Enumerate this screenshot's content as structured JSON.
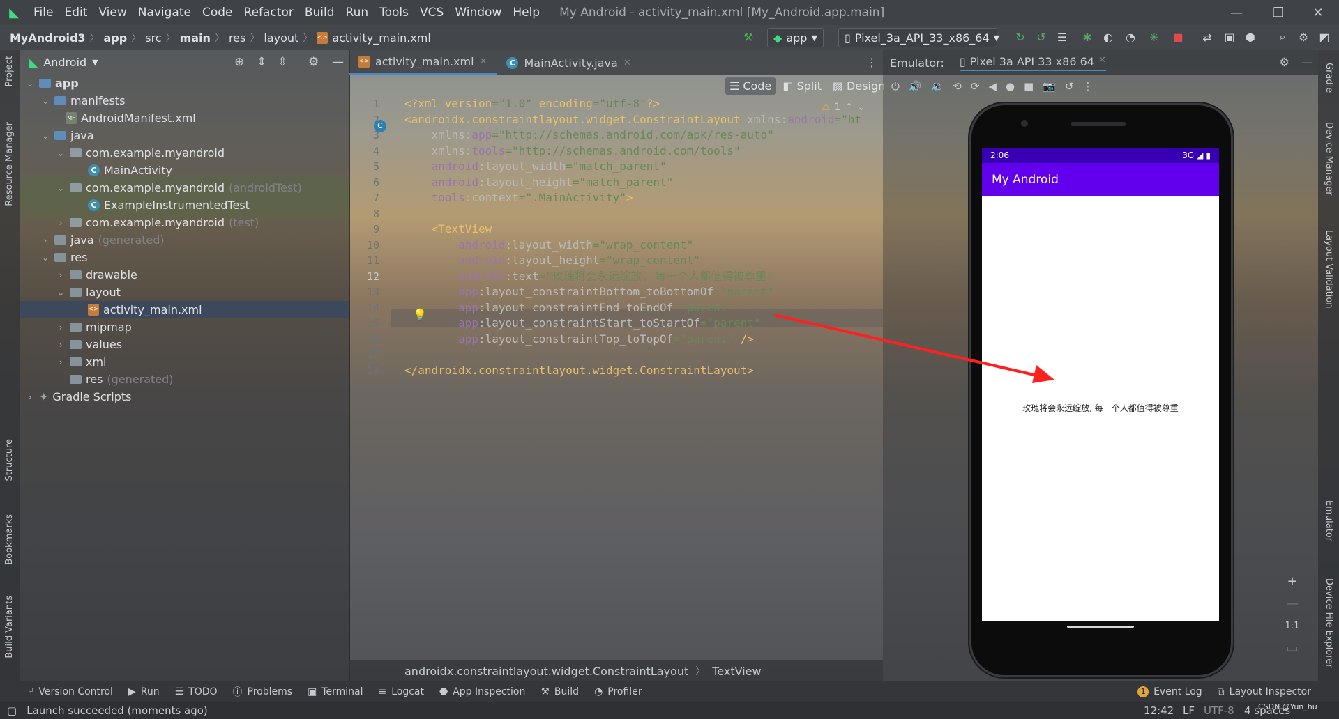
{
  "menubar": {
    "items": [
      "File",
      "Edit",
      "View",
      "Navigate",
      "Code",
      "Refactor",
      "Build",
      "Run",
      "Tools",
      "VCS",
      "Window",
      "Help"
    ],
    "title": "My Android - activity_main.xml [My_Android.app.main]"
  },
  "navbar": {
    "crumbs": [
      "MyAndroid3",
      "app",
      "src",
      "main",
      "res",
      "layout",
      "activity_main.xml"
    ],
    "run_config": "app",
    "device": "Pixel_3a_API_33_x86_64"
  },
  "left_strip": {
    "project": "Project",
    "resource_manager": "Resource Manager",
    "structure": "Structure",
    "bookmarks": "Bookmarks",
    "build_variants": "Build Variants"
  },
  "right_strip": {
    "gradle": "Gradle",
    "device_manager": "Device Manager",
    "layout_validation": "Layout Validation",
    "emulator": "Emulator",
    "device_file_explorer": "Device File Explorer"
  },
  "project": {
    "view_mode": "Android",
    "tree": [
      {
        "label": "app",
        "suffix": ""
      },
      {
        "label": "manifests",
        "suffix": ""
      },
      {
        "label": "AndroidManifest.xml",
        "suffix": ""
      },
      {
        "label": "java",
        "suffix": ""
      },
      {
        "label": "com.example.myandroid",
        "suffix": ""
      },
      {
        "label": "MainActivity",
        "suffix": ""
      },
      {
        "label": "com.example.myandroid",
        "suffix": "(androidTest)"
      },
      {
        "label": "ExampleInstrumentedTest",
        "suffix": ""
      },
      {
        "label": "com.example.myandroid",
        "suffix": "(test)"
      },
      {
        "label": "java",
        "suffix": "(generated)"
      },
      {
        "label": "res",
        "suffix": ""
      },
      {
        "label": "drawable",
        "suffix": ""
      },
      {
        "label": "layout",
        "suffix": ""
      },
      {
        "label": "activity_main.xml",
        "suffix": ""
      },
      {
        "label": "mipmap",
        "suffix": ""
      },
      {
        "label": "values",
        "suffix": ""
      },
      {
        "label": "xml",
        "suffix": ""
      },
      {
        "label": "res",
        "suffix": "(generated)"
      },
      {
        "label": "Gradle Scripts",
        "suffix": ""
      }
    ]
  },
  "editor": {
    "tabs": [
      "activity_main.xml",
      "MainActivity.java"
    ],
    "modes": [
      "Code",
      "Split",
      "Design"
    ],
    "warnings": "1",
    "line_numbers": [
      "1",
      "2",
      "3",
      "4",
      "5",
      "6",
      "7",
      "8",
      "9",
      "10",
      "11",
      "12",
      "13",
      "14",
      "15",
      "16",
      "17",
      "18"
    ],
    "lines": [
      [
        [
          "tg",
          "<?xml version"
        ],
        [
          "sv",
          "=\"1.0\""
        ],
        [
          "tg",
          " encoding"
        ],
        [
          "sv",
          "=\"utf-8\""
        ],
        [
          "tg",
          "?>"
        ]
      ],
      [
        [
          "tg",
          "<androidx.constraintlayout.widget.ConstraintLayout "
        ],
        [
          "at",
          "xmlns:"
        ],
        [
          "ns",
          "android"
        ],
        [
          "sv",
          "=\"ht"
        ]
      ],
      [
        [
          "at",
          "    xmlns:"
        ],
        [
          "ns",
          "app"
        ],
        [
          "sv",
          "=\"http://schemas.android.com/apk/res-auto\""
        ]
      ],
      [
        [
          "at",
          "    xmlns:"
        ],
        [
          "ns",
          "tools"
        ],
        [
          "sv",
          "=\"http://schemas.android.com/tools\""
        ]
      ],
      [
        [
          "ns",
          "    android"
        ],
        [
          "at",
          ":layout_width"
        ],
        [
          "sv",
          "=\"match_parent\""
        ]
      ],
      [
        [
          "ns",
          "    android"
        ],
        [
          "at",
          ":layout_height"
        ],
        [
          "sv",
          "=\"match_parent\""
        ]
      ],
      [
        [
          "ns",
          "    tools"
        ],
        [
          "at",
          ":context"
        ],
        [
          "sv",
          "=\".MainActivity\""
        ],
        [
          "tg",
          ">"
        ]
      ],
      [
        [
          "pl",
          ""
        ]
      ],
      [
        [
          "tg",
          "    <TextView"
        ]
      ],
      [
        [
          "ns",
          "        android"
        ],
        [
          "at",
          ":layout_width"
        ],
        [
          "sv",
          "=\"wrap_content\""
        ]
      ],
      [
        [
          "ns",
          "        android"
        ],
        [
          "at",
          ":layout_height"
        ],
        [
          "sv",
          "=\"wrap_content\""
        ]
      ],
      [
        [
          "ns",
          "        android"
        ],
        [
          "at",
          ":text"
        ],
        [
          "sv",
          "=\"玫瑰将会永远绽放, 每一个人都值得被尊重\""
        ]
      ],
      [
        [
          "ns",
          "        app"
        ],
        [
          "at",
          ":layout_constraintBottom_toBottomOf"
        ],
        [
          "sv",
          "=\"parent\""
        ]
      ],
      [
        [
          "ns",
          "        app"
        ],
        [
          "at",
          ":layout_constraintEnd_toEndOf"
        ],
        [
          "sv",
          "=\"parent\""
        ]
      ],
      [
        [
          "ns",
          "        app"
        ],
        [
          "at",
          ":layout_constraintStart_toStartOf"
        ],
        [
          "sv",
          "=\"parent\""
        ]
      ],
      [
        [
          "ns",
          "        app"
        ],
        [
          "at",
          ":layout_constraintTop_toTopOf"
        ],
        [
          "sv",
          "=\"parent\""
        ],
        [
          "tg",
          " />"
        ]
      ],
      [
        [
          "pl",
          ""
        ]
      ],
      [
        [
          "tg",
          "</androidx.constraintlayout.widget.ConstraintLayout>"
        ]
      ]
    ],
    "breadcrumb": [
      "androidx.constraintlayout.widget.ConstraintLayout",
      "TextView"
    ]
  },
  "emulator": {
    "label": "Emulator:",
    "device": "Pixel 3a API 33 x86 64",
    "status_time": "2:06",
    "status_right": "3G",
    "app_title": "My Android",
    "text": "玫瑰将会永远绽放, 每一个人都值得被尊重",
    "zoom_one": "1:1"
  },
  "bottom_tabs": [
    "Version Control",
    "Run",
    "TODO",
    "Problems",
    "Terminal",
    "Logcat",
    "App Inspection",
    "Build",
    "Profiler"
  ],
  "bottom_right": {
    "event_log": "Event Log",
    "layout_inspector": "Layout Inspector",
    "event_count": "1"
  },
  "status": {
    "message": "Launch succeeded (moments ago)",
    "position": "12:42",
    "line_sep": "LF",
    "encoding": "UTF-8",
    "indent": "4 spaces",
    "watermark": "CSDN @Yun_hu"
  }
}
